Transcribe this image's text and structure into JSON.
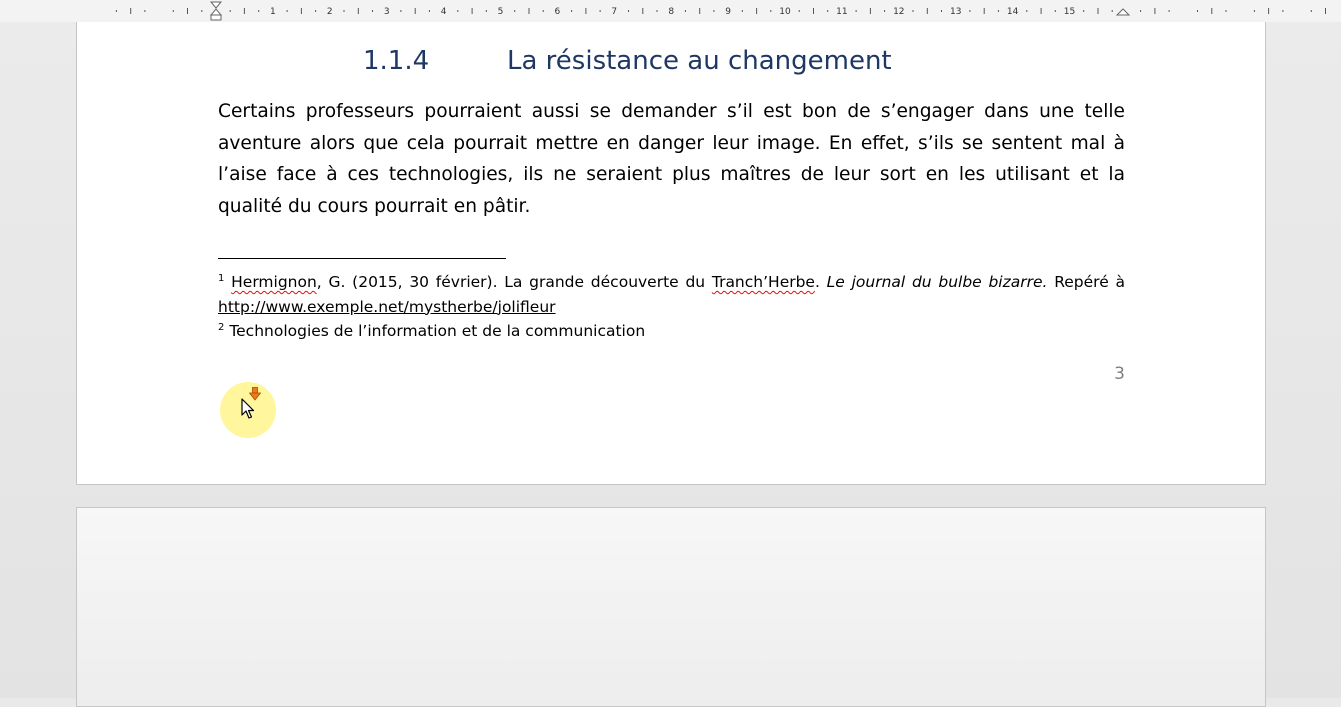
{
  "ruler": {
    "marks": [
      "1",
      "2",
      "3",
      "4",
      "5",
      "6",
      "7",
      "8",
      "9",
      "10",
      "11",
      "12",
      "13",
      "14",
      "15"
    ]
  },
  "page3": {
    "heading_number": "1.1.4",
    "heading_title": "La résistance au changement",
    "body": "Certains professeurs pourraient aussi se demander s’il est bon de s’engager dans une telle aventure alors que cela pourrait mettre en danger leur image. En effet, s’ils se sentent mal à l’aise face à ces technologies, ils ne seraient plus maîtres de leur sort en les utilisant et la qualité du cours pourrait en pâtir.",
    "footnotes": [
      {
        "mark": "1",
        "author": "Hermignon",
        "part1": ", G. (2015, 30 février). La grande découverte du ",
        "term": "Tranch’Herbe",
        "part2": ". ",
        "journal": "Le journal du bulbe bizarre.",
        "part3": " Repéré à",
        "url": "http://www.exemple.net/mystherbe/jolifleur"
      },
      {
        "mark": "2",
        "text": "Technologies de l’information et de la communication"
      }
    ],
    "page_number": "3"
  },
  "cursor": {
    "highlight_color": "#fff58c",
    "icon": "mouse-pointer-icon",
    "click_indicator": "click-arrow-icon"
  }
}
